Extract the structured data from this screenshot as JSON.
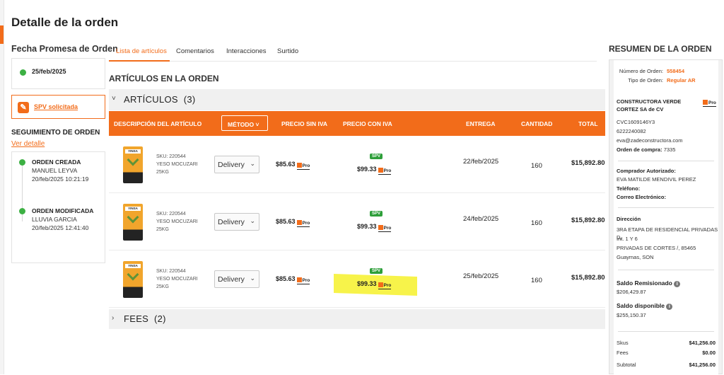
{
  "page": {
    "title": "Detalle de la orden"
  },
  "promesa": {
    "title": "Fecha Promesa de Orden",
    "date": "25/feb/2025"
  },
  "spv": {
    "label": "SPV solicitada"
  },
  "seguimiento": {
    "title": "SEGUIMIENTO DE ORDEN",
    "link": "Ver detalle",
    "events": [
      {
        "title": "ORDEN CREADA",
        "user": "MANUEL LEYVA",
        "datetime": "20/feb/2025 10:21:19"
      },
      {
        "title": "ORDEN MODIFICADA",
        "user": "LLUVIA GARCIA",
        "datetime": "20/feb/2025 12:41:40"
      }
    ]
  },
  "tabs": [
    "Lista de artículos",
    "Comentarios",
    "Interacciones",
    "Surtido"
  ],
  "articles": {
    "section_title": "ARTÍCULOS EN LA ORDEN",
    "group_label": "ARTÍCULOS",
    "group_count": "(3)",
    "columns": {
      "descripcion": "DESCRIPCIÓN DEL ARTÍCULO",
      "metodo": "MÉTODO",
      "sin_iva": "PRECIO SIN IVA",
      "con_iva": "PRECIO CON IVA",
      "entrega": "ENTREGA",
      "cantidad": "CANTIDAD",
      "total": "TOTAL"
    },
    "rows": [
      {
        "sku": "SKU: 220544",
        "name1": "YESO MOCUZARI",
        "name2": "25KG",
        "metodo": "Delivery",
        "sin_iva": "$85.63",
        "spv": "SPV",
        "con_iva": "$99.33",
        "entrega": "22/feb/2025",
        "cantidad": "160",
        "total": "$15,892.80"
      },
      {
        "sku": "SKU: 220544",
        "name1": "YESO MOCUZARI",
        "name2": "25KG",
        "metodo": "Delivery",
        "sin_iva": "$85.63",
        "spv": "SPV",
        "con_iva": "$99.33",
        "entrega": "24/feb/2025",
        "cantidad": "160",
        "total": "$15,892.80"
      },
      {
        "sku": "SKU: 220544",
        "name1": "YESO MOCUZARI",
        "name2": "25KG",
        "metodo": "Delivery",
        "sin_iva": "$85.63",
        "spv": "SPV",
        "con_iva": "$99.33",
        "entrega": "25/feb/2025",
        "cantidad": "160",
        "total": "$15,892.80"
      }
    ],
    "product_logo": "YINSA",
    "pro_badge": "Pro",
    "fees_label": "FEES",
    "fees_count": "(2)"
  },
  "resumen": {
    "title": "RESUMEN DE LA ORDEN",
    "numero_label": "Número de Orden:",
    "numero_value": "558454",
    "tipo_label": "Tipo de Orden:",
    "tipo_value": "Regular AR",
    "empresa": "CONSTRUCTORA VERDE CORTEZ SA de CV",
    "rfc": "CVC1609146Y3",
    "telefono": "6222240082",
    "email": "eva@zadeconstructora.com",
    "oc_label": "Orden de compra:",
    "oc_value": "7335",
    "comprador_label": "Comprador Autorizado:",
    "comprador_value": "EVA MATILDE MENDIVIL PEREZ",
    "tel_label": "Teléfono:",
    "correo_label": "Correo Electrónico:",
    "direccion_label": "Dirección",
    "direccion_lines": [
      "3RA ETAPA DE RESIDENCIAL PRIVADAS D,",
      "Int. 1 Y 6",
      "PRIVADAS DE CORTES /, 85465",
      "Guaymas, SON"
    ],
    "saldo_rem_label": "Saldo Remisionado",
    "saldo_rem_value": "$206,429.87",
    "saldo_disp_label": "Saldo disponible",
    "saldo_disp_value": "$255,150.37",
    "totals": [
      {
        "label": "Skus",
        "value": "$41,256.00"
      },
      {
        "label": "Fees",
        "value": "$0.00"
      },
      {
        "label": "Subtotal",
        "value": "$41,256.00"
      }
    ]
  },
  "colors": {
    "accent": "#f26c1a",
    "green": "#3cb043",
    "highlight": "#f7f34a"
  }
}
